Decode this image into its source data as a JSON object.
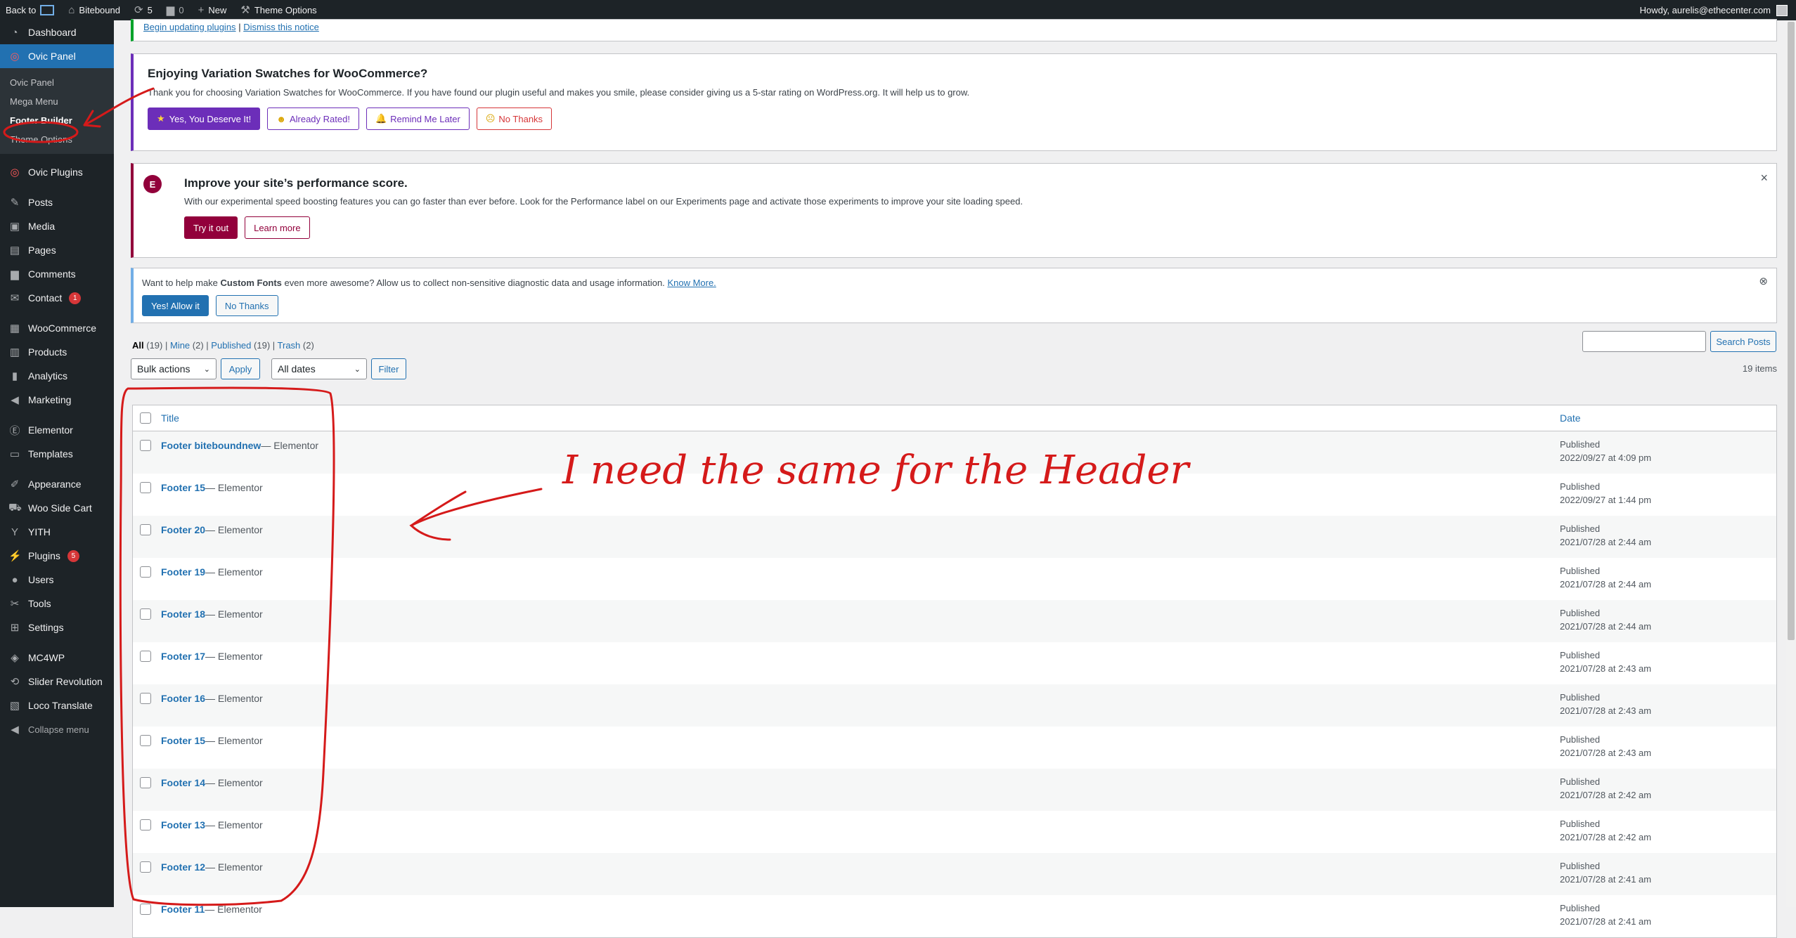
{
  "adminbar": {
    "back_to": "Back to",
    "site_name": "Bitebound",
    "updates_count": "5",
    "comments_count": "0",
    "new_label": "New",
    "theme_options": "Theme Options",
    "howdy": "Howdy, aurelis@ethecenter.com"
  },
  "menu": {
    "dashboard": "Dashboard",
    "ovic_panel": "Ovic Panel",
    "sub_ovic_panel": "Ovic Panel",
    "sub_mega_menu": "Mega Menu",
    "sub_footer_builder": "Footer Builder",
    "sub_theme_options": "Theme Options",
    "ovic_plugins": "Ovic Plugins",
    "posts": "Posts",
    "media": "Media",
    "pages": "Pages",
    "comments": "Comments",
    "contact": "Contact",
    "contact_badge": "1",
    "woocommerce": "WooCommerce",
    "products": "Products",
    "analytics": "Analytics",
    "marketing": "Marketing",
    "elementor": "Elementor",
    "templates": "Templates",
    "appearance": "Appearance",
    "woo_side_cart": "Woo Side Cart",
    "yith": "YITH",
    "plugins": "Plugins",
    "plugins_badge": "5",
    "users": "Users",
    "tools": "Tools",
    "settings": "Settings",
    "mc4wp": "MC4WP",
    "slider_revolution": "Slider Revolution",
    "loco_translate": "Loco Translate",
    "collapse": "Collapse menu"
  },
  "notices": {
    "top_link1": "Begin updating plugins",
    "top_sep": "|",
    "top_link2": "Dismiss this notice",
    "swatches_title": "Enjoying Variation Swatches for WooCommerce?",
    "swatches_text": "Thank you for choosing Variation Swatches for WooCommerce. If you have found our plugin useful and makes you smile, please consider giving us a 5-star rating on WordPress.org. It will help us to grow.",
    "swatches_btn1": "Yes, You Deserve It!",
    "swatches_btn2": "Already Rated!",
    "swatches_btn3": "Remind Me Later",
    "swatches_btn4": "No Thanks",
    "elementor_title": "Improve your site’s performance score.",
    "elementor_text": "With our experimental speed boosting features you can go faster than ever before. Look for the Performance label on our Experiments page and activate those experiments to improve your site loading speed.",
    "elementor_btn1": "Try it out",
    "elementor_btn2": "Learn more",
    "fonts_text1": "Want to help make",
    "fonts_bold": "Custom Fonts",
    "fonts_text2": "even more awesome? Allow us to collect non-sensitive diagnostic data and usage information.",
    "fonts_link": "Know More.",
    "fonts_btn1": "Yes! Allow it",
    "fonts_btn2": "No Thanks"
  },
  "list": {
    "all": "All",
    "all_count": "(19)",
    "mine": "Mine",
    "mine_count": "(2)",
    "published": "Published",
    "published_count": "(19)",
    "trash": "Trash",
    "trash_count": "(2)",
    "bulk_actions": "Bulk actions",
    "apply": "Apply",
    "all_dates": "All dates",
    "filter": "Filter",
    "search_btn": "Search Posts",
    "items_count": "19 items",
    "col_title": "Title",
    "col_date": "Date"
  },
  "rows": [
    {
      "title": "Footer biteboundnew",
      "state": " — Elementor",
      "status": "Published",
      "date": "2022/09/27 at 4:09 pm"
    },
    {
      "title": "Footer 15",
      "state": " — Elementor",
      "status": "Published",
      "date": "2022/09/27 at 1:44 pm"
    },
    {
      "title": "Footer 20",
      "state": " — Elementor",
      "status": "Published",
      "date": "2021/07/28 at 2:44 am"
    },
    {
      "title": "Footer 19",
      "state": " — Elementor",
      "status": "Published",
      "date": "2021/07/28 at 2:44 am"
    },
    {
      "title": "Footer 18",
      "state": " — Elementor",
      "status": "Published",
      "date": "2021/07/28 at 2:44 am"
    },
    {
      "title": "Footer 17",
      "state": " — Elementor",
      "status": "Published",
      "date": "2021/07/28 at 2:43 am"
    },
    {
      "title": "Footer 16",
      "state": " — Elementor",
      "status": "Published",
      "date": "2021/07/28 at 2:43 am"
    },
    {
      "title": "Footer 15",
      "state": " — Elementor",
      "status": "Published",
      "date": "2021/07/28 at 2:43 am"
    },
    {
      "title": "Footer 14",
      "state": " — Elementor",
      "status": "Published",
      "date": "2021/07/28 at 2:42 am"
    },
    {
      "title": "Footer 13",
      "state": " — Elementor",
      "status": "Published",
      "date": "2021/07/28 at 2:42 am"
    },
    {
      "title": "Footer 12",
      "state": " — Elementor",
      "status": "Published",
      "date": "2021/07/28 at 2:41 am"
    },
    {
      "title": "Footer 11",
      "state": " — Elementor",
      "status": "Published",
      "date": "2021/07/28 at 2:41 am"
    }
  ],
  "annotation": {
    "text": "I need the same for the Header",
    "color": "#d51a1a"
  }
}
